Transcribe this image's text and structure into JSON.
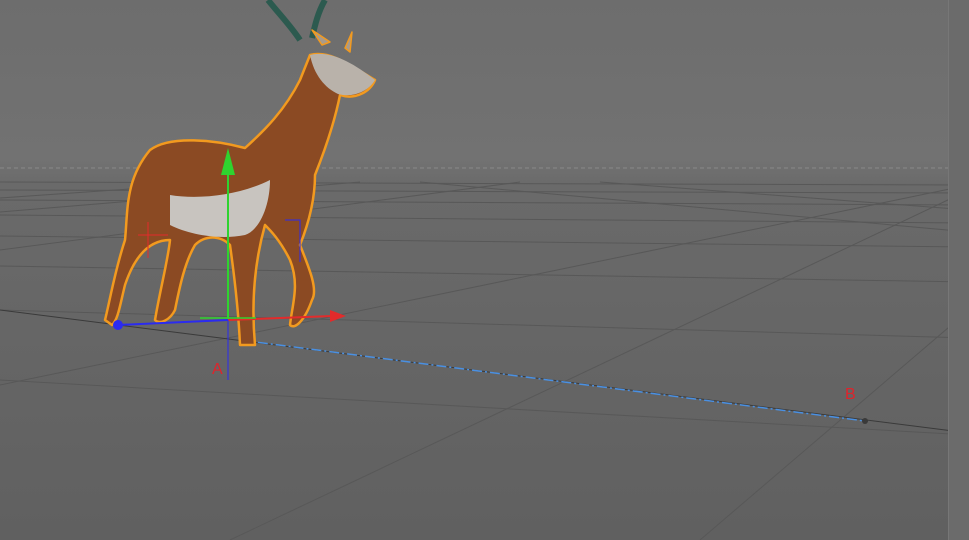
{
  "viewport": {
    "markers": {
      "start_label": "A",
      "end_label": "B"
    },
    "colors": {
      "background": "#6f6f6f",
      "grid_line": "#5a5a5a",
      "selection_outline": "#f29a1f",
      "axis_x": "#e32b2b",
      "axis_y": "#2fd32f",
      "axis_z": "#2b2bf0",
      "path_line": "#4a90e2",
      "marker_label": "#e0232b"
    },
    "selected_object": "antelope-model",
    "icons": [
      "move-gizmo-icon",
      "antelope-model-icon",
      "point-marker-icon"
    ]
  }
}
